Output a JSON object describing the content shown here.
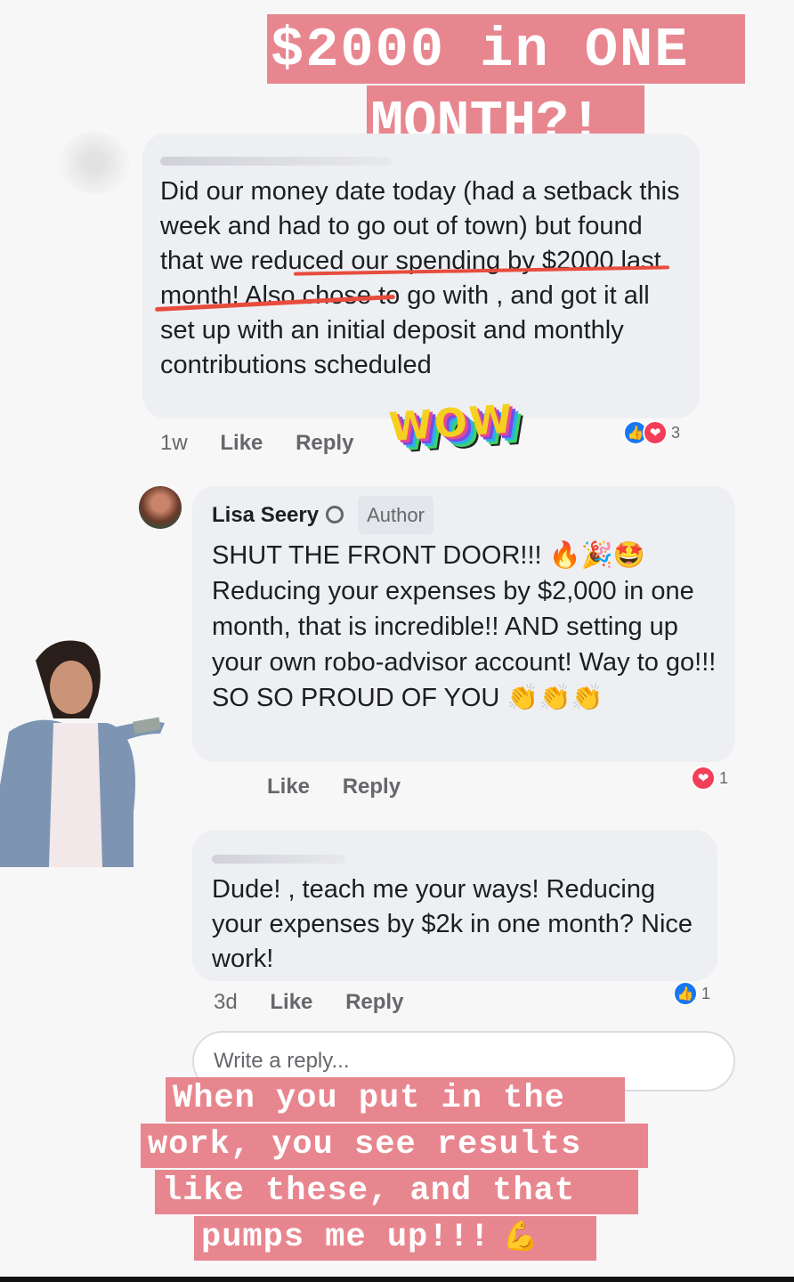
{
  "headline": {
    "line1": "$2000 in ONE",
    "line2": "MONTH?!"
  },
  "comment1": {
    "text": "Did our money date today (had a setback this week and had to go out of town) but found that we reduced our spending by $2000 last month! Also chose to go with , and got it all set up with an initial deposit and monthly contributions scheduled",
    "time": "1w",
    "like_label": "Like",
    "reply_label": "Reply",
    "reaction_count": "3"
  },
  "sticker_wow": "WOW",
  "comment2": {
    "author": "Lisa Seery",
    "author_tag": "Author",
    "text": "SHUT THE FRONT DOOR!!! 🔥🎉🤩Reducing your expenses by $2,000 in one month, that is incredible!! AND setting up your own robo-advisor account! Way to go!!! SO SO PROUD OF YOU 👏👏👏",
    "like_label": "Like",
    "reply_label": "Reply",
    "reaction_count": "1"
  },
  "comment3": {
    "text": "Dude! , teach me your ways! Reducing your expenses by $2k in one month? Nice work!",
    "time": "3d",
    "like_label": "Like",
    "reply_label": "Reply",
    "reaction_count": "1"
  },
  "reply_input": {
    "placeholder": "Write a reply..."
  },
  "caption": {
    "line1": "When you put in the",
    "line2": "work, you see results",
    "line3": "like these, and that",
    "line4": "pumps me up!!!"
  },
  "colors": {
    "sticker_bg": "#e8868f",
    "bubble_bg": "#eeeff3",
    "like_blue": "#1877f2",
    "love_red": "#f33e58"
  },
  "icons": [
    "like-icon",
    "love-icon",
    "verified-badge-icon",
    "flexed-biceps-icon"
  ]
}
